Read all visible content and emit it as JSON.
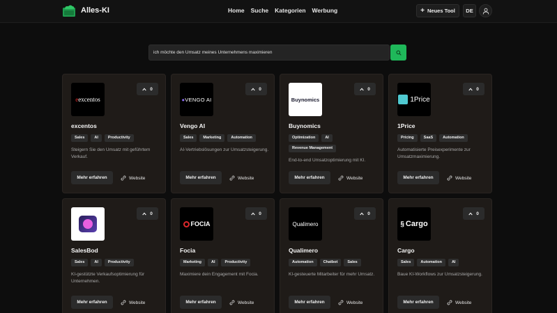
{
  "header": {
    "brand": "Alles-KI",
    "logo_icon": "cloud-box-icon",
    "nav": [
      "Home",
      "Suche",
      "Kategorien",
      "Werbung"
    ],
    "new_tool_label": "Neues Tool",
    "language": "DE",
    "user_icon": "user-icon"
  },
  "search": {
    "value": "ich möchte den Umsatz meines Unternehmens maximieren",
    "button_icon": "search-icon"
  },
  "colors": {
    "accent_green": "#1fb85a",
    "card_bg": "#1f1b18",
    "page_bg": "#0d0d0d"
  },
  "cards": [
    {
      "title": "excentos",
      "votes": "0",
      "logo_text": "excentos",
      "tags": [
        "Sales",
        "AI",
        "Productivity"
      ],
      "desc": "Steigern Sie den Umsatz mit geführtem Verkauf.",
      "more": "Mehr erfahren",
      "website": "Website"
    },
    {
      "title": "Vengo AI",
      "votes": "0",
      "logo_text": "VENGO AI",
      "tags": [
        "Sales",
        "Marketing",
        "Automation"
      ],
      "desc": "AI-Vertriebslösungen zur Umsatzsteigerung.",
      "more": "Mehr erfahren",
      "website": "Website"
    },
    {
      "title": "Buynomics",
      "votes": "0",
      "logo_text": "Buynomics",
      "tags": [
        "Optimization",
        "AI",
        "Revenue Management"
      ],
      "desc": "End-to-end Umsatzoptimierung mit KI.",
      "more": "Mehr erfahren",
      "website": "Website"
    },
    {
      "title": "1Price",
      "votes": "0",
      "logo_text": "1Price",
      "tags": [
        "Pricing",
        "SaaS",
        "Automation"
      ],
      "desc": "Automatisierte Preisexperimente zur Umsatzmaximierung.",
      "more": "Mehr erfahren",
      "website": "Website"
    },
    {
      "title": "SalesBod",
      "votes": "0",
      "logo_text": "",
      "tags": [
        "Sales",
        "AI",
        "Productivity"
      ],
      "desc": "KI-gestützte Verkaufsoptimierung für Unternehmen.",
      "more": "Mehr erfahren",
      "website": "Website"
    },
    {
      "title": "Focia",
      "votes": "0",
      "logo_text": "FOCIA",
      "tags": [
        "Marketing",
        "AI",
        "Productivity"
      ],
      "desc": "Maximiere dein Engagement mit Focia.",
      "more": "Mehr erfahren",
      "website": "Website"
    },
    {
      "title": "Qualimero",
      "votes": "0",
      "logo_text": "Qualimero",
      "tags": [
        "Automation",
        "Chatbot",
        "Sales"
      ],
      "desc": "KI-gesteuerte Mitarbeiter für mehr Umsatz.",
      "more": "Mehr erfahren",
      "website": "Website"
    },
    {
      "title": "Cargo",
      "votes": "0",
      "logo_text": "Cargo",
      "tags": [
        "Sales",
        "Automation",
        "AI"
      ],
      "desc": "Baue KI-Workflows zur Umsatzsteigerung.",
      "more": "Mehr erfahren",
      "website": "Website"
    }
  ]
}
